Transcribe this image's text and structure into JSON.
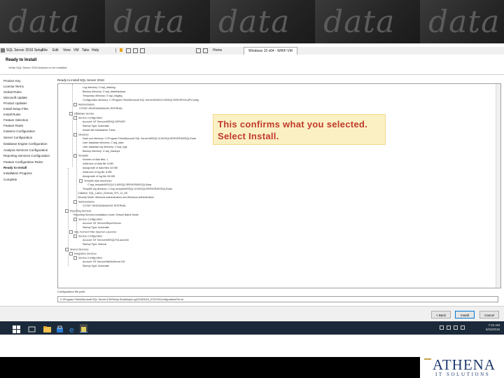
{
  "banner": {
    "watermark": "data"
  },
  "window": {
    "title": "SQL Server 2016 Setup",
    "menu": [
      "File",
      "Edit",
      "View",
      "VM",
      "Tabs",
      "Help"
    ],
    "tabs": [
      "Home",
      "Windows 10 x64 - WWF-VM"
    ]
  },
  "header": {
    "title": "Ready to Install",
    "subtitle": "Verify SQL Server 2016 features to be installed."
  },
  "sidebar": {
    "items": [
      "Product Key",
      "License Terms",
      "Global Rules",
      "Microsoft Update",
      "Product Updates",
      "Install Setup Files",
      "Install Rules",
      "Feature Selection",
      "Feature Rules",
      "Instance Configuration",
      "Server Configuration",
      "Database Engine Configuration",
      "Analysis Services Configuration",
      "Reporting Services Configuration",
      "Feature Configuration Rules",
      "Ready to Install",
      "Installation Progress",
      "Complete"
    ],
    "current_index": 15
  },
  "tree": {
    "title": "Ready to install SQL Server 2016:",
    "lines": [
      "Log directory: C:\\sql_data\\log",
      "Backup directory: C:\\sql_data\\backups",
      "Temporary directory: C:\\sql_staging",
      "Configuration directory: C:\\Program Files\\Microsoft SQL Server\\MSAS13.MSSQLSERVER\\OLAP\\Config",
      "Administrators",
      "CCSD\\*.HINZDANAAW.MZ.INTERNAL",
      "Database Service",
      "Service Configuration",
      "Account: NT Service\\MSSQLSERVER",
      "Startup Type: Automatic",
      "Instant file initialization: False",
      "Directory",
      "Data root directory: C:\\Program Files\\Microsoft SQL Server\\MSSQL13.MSSQLSERVER\\MSSQL\\Data",
      "User database directory: C:\\sql_data",
      "User database log directory: C:\\sql_logs",
      "Backup directory: C:\\sql_backups",
      "TempDB",
      "Number of data files: 1",
      "Initial size of data file: 8 MB",
      "Autogrowth of data files: 64 MB",
      "Initial size of log file: 8 MB",
      "Autogrowth of log file: 64 MB",
      "TempDB data directories:",
      "C:\\sql_tempdb\\MSSQL13.MSSQLSERVER\\MSSQL\\Data",
      "TempDB log directory: C:\\sql_tempdb\\MSSQL13.MSSQLSERVER\\MSSQL\\Data",
      "Collation: SQL_Latin1_General_CP1_CI_AS",
      "Security Mode: Windows authentication and Windows authentication",
      "Administrators",
      "CCSD\\*.HINZDANAAW.MZ.INTERNAL",
      "Reporting Services",
      "Reporting Services installation mode: Default Native Mode",
      "Service Configuration",
      "Account: NT Service\\ReportServer",
      "Startup Type: Automatic",
      "SQL Full-text Filter Daemon Launcher",
      "Service Configuration",
      "Account: NT Service\\MSSQLFDLauncher",
      "Startup Type: Manual",
      "Shared Services",
      "Integration Services",
      "Service Configuration",
      "Account: NT Service\\MsDtsServer130",
      "Startup Type: Automatic"
    ]
  },
  "config": {
    "label": "Configuration file path:",
    "path": "C:\\Program Files\\Microsoft SQL Server\\130\\Setup Bootstrap\\Log\\20160616_072219\\ConfigurationFile.ini"
  },
  "buttons": {
    "back": "< Back",
    "install": "Install",
    "cancel": "Cancel"
  },
  "taskbar": {
    "time": "7:22 AM",
    "date": "6/16/2016"
  },
  "callout": {
    "line1": "This confirms what you selected.",
    "line2": "Select Install."
  },
  "logo": {
    "name": "ATHENA",
    "tagline": "IT SOLUTIONS"
  },
  "colors": {
    "callout_bg": "#fbf0c4",
    "callout_text": "#c0392b",
    "taskbar": "#1b2a3a",
    "logo": "#1f3b6e"
  }
}
